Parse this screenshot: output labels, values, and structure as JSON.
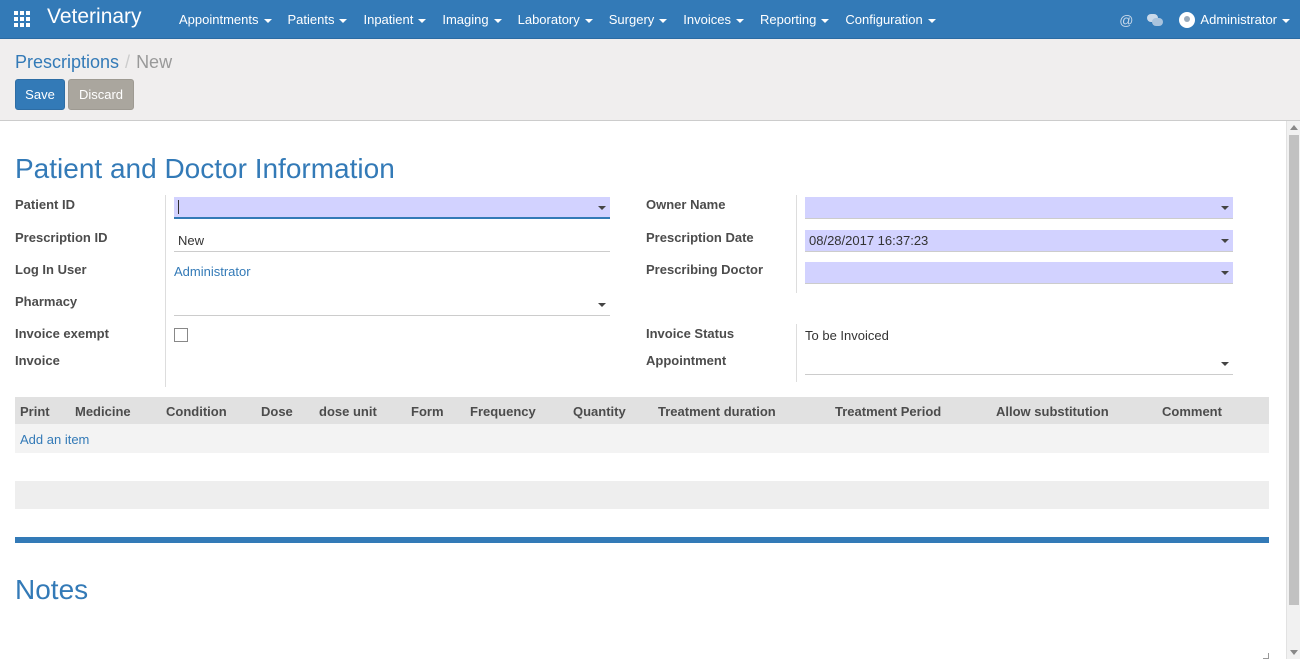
{
  "app": {
    "title": "Veterinary",
    "menu": [
      "Appointments",
      "Patients",
      "Inpatient",
      "Imaging",
      "Laboratory",
      "Surgery",
      "Invoices",
      "Reporting",
      "Configuration"
    ],
    "user": "Administrator",
    "at_symbol": "@"
  },
  "breadcrumb": {
    "parent": "Prescriptions",
    "separator": "/",
    "current": "New"
  },
  "buttons": {
    "save": "Save",
    "discard": "Discard"
  },
  "form": {
    "section_title": "Patient and Doctor Information",
    "left_labels": {
      "patient_id": "Patient ID",
      "prescription_id": "Prescription ID",
      "log_in_user": "Log In User",
      "pharmacy": "Pharmacy",
      "invoice_exempt": "Invoice exempt",
      "invoice": "Invoice"
    },
    "left_values": {
      "patient_id": "",
      "prescription_id": "New",
      "log_in_user": "Administrator",
      "pharmacy": ""
    },
    "right_labels": {
      "owner_name": "Owner Name",
      "prescription_date": "Prescription Date",
      "prescribing_doctor": "Prescribing Doctor",
      "invoice_status": "Invoice Status",
      "appointment": "Appointment"
    },
    "right_values": {
      "owner_name": "",
      "prescription_date": "08/28/2017 16:37:23",
      "prescribing_doctor": "",
      "invoice_status": "To be Invoiced",
      "appointment": ""
    },
    "colors": {
      "required_bg": "#d2d2ff",
      "brand": "#337ab7"
    }
  },
  "table": {
    "columns": [
      "Print",
      "Medicine",
      "Condition",
      "Dose",
      "dose unit",
      "Form",
      "Frequency",
      "Quantity",
      "Treatment duration",
      "Treatment Period",
      "Allow substitution",
      "Comment"
    ],
    "add_item": "Add an item"
  },
  "notes": {
    "title": "Notes"
  }
}
